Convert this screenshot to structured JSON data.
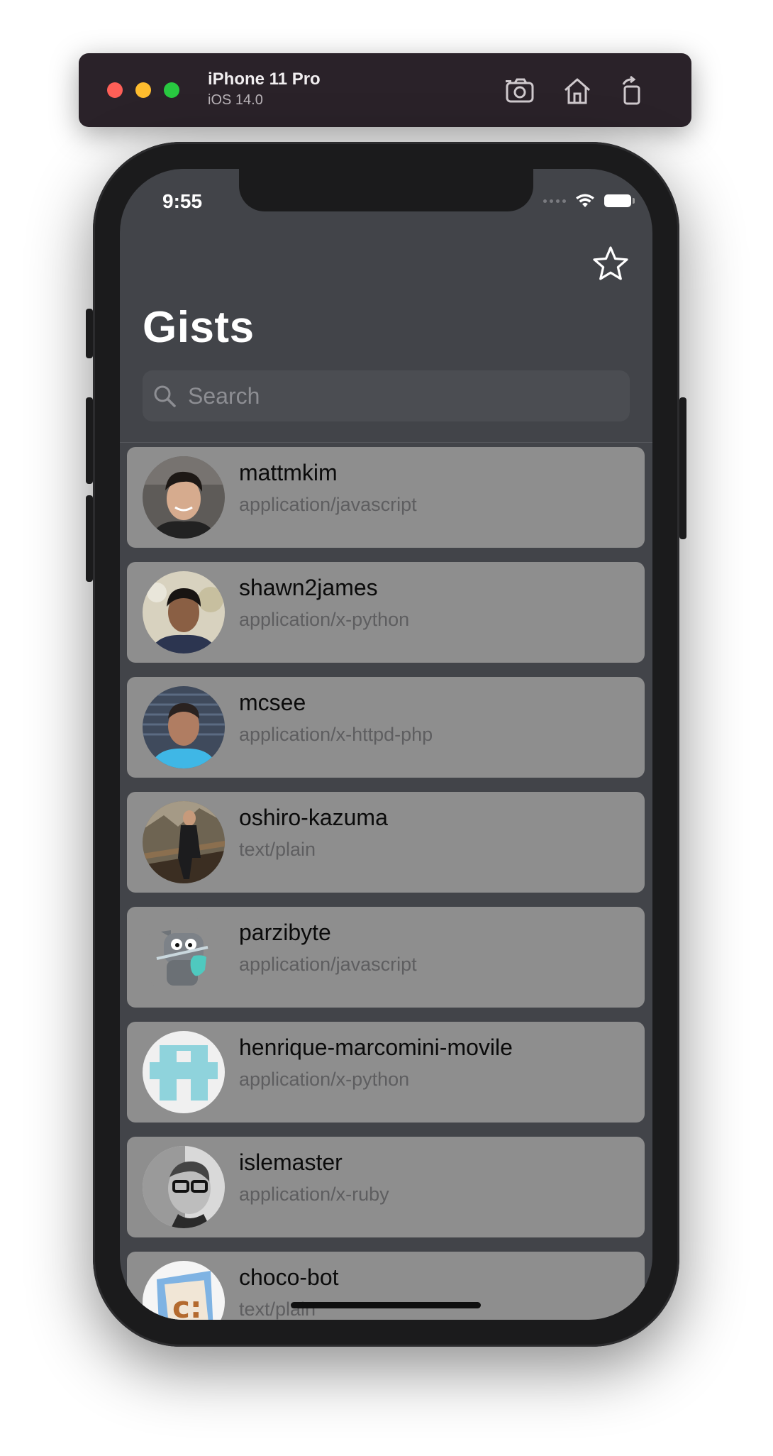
{
  "simulator": {
    "device_name": "iPhone 11 Pro",
    "os_version": "iOS 14.0",
    "buttons": [
      "screenshot-icon",
      "home-icon",
      "rotate-icon"
    ]
  },
  "status_bar": {
    "time": "9:55",
    "icons": [
      "cellular-dots-icon",
      "wifi-icon",
      "battery-icon"
    ]
  },
  "nav": {
    "title": "Gists",
    "favorite_icon": "star-icon"
  },
  "search": {
    "placeholder": "Search",
    "value": ""
  },
  "gists": [
    {
      "owner": "mattmkim",
      "type": "application/javascript"
    },
    {
      "owner": "shawn2james",
      "type": "application/x-python"
    },
    {
      "owner": "mcsee",
      "type": "application/x-httpd-php"
    },
    {
      "owner": "oshiro-kazuma",
      "type": "text/plain"
    },
    {
      "owner": "parzibyte",
      "type": "application/javascript"
    },
    {
      "owner": "henrique-marcomini-movile",
      "type": "application/x-python"
    },
    {
      "owner": "islemaster",
      "type": "application/x-ruby"
    },
    {
      "owner": "choco-bot",
      "type": "text/plain"
    }
  ],
  "colors": {
    "screen_background": "#424449",
    "card_background": "#8e8e8e",
    "title_text": "#ffffff"
  }
}
